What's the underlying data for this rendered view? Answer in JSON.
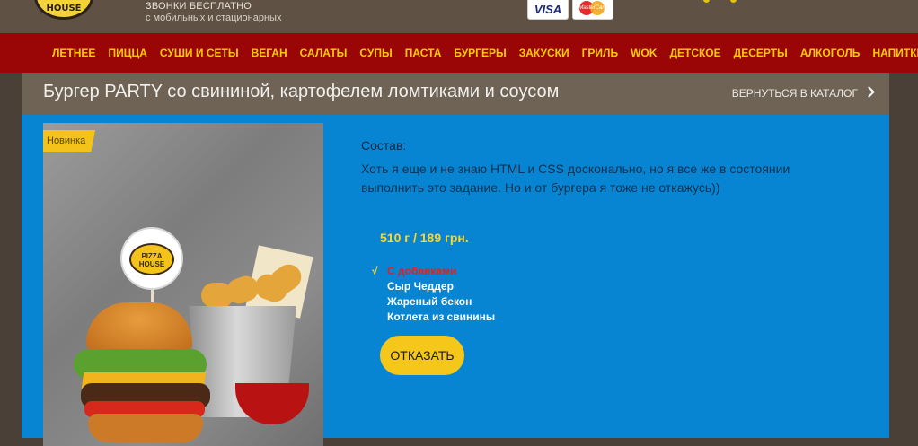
{
  "header": {
    "logo_text": "HOUSE",
    "calls_line1": "ЗВОНКИ БЕСПЛАТНО",
    "calls_line2": "с мобильных и стационарных",
    "payment_cards": [
      "VISA",
      "MasterCard"
    ]
  },
  "nav": {
    "items": [
      "ЛЕТНЕЕ",
      "ПИЦЦА",
      "СУШИ И СЕТЫ",
      "ВЕГАН",
      "САЛАТЫ",
      "СУПЫ",
      "ПАСТА",
      "БУРГЕРЫ",
      "ЗАКУСКИ",
      "ГРИЛЬ",
      "WOK",
      "ДЕТСКОЕ",
      "ДЕСЕРТЫ",
      "АЛКОГОЛЬ",
      "НАПИТКИ"
    ]
  },
  "page": {
    "title": "Бургер PARTY со свининой, картофелем ломтиками и соусом",
    "back_link": "ВЕРНУТЬСЯ В КАТАЛОГ"
  },
  "product": {
    "badge": "Новинка",
    "flag_text": "PIZZA HOUSE",
    "composition_label": "Состав:",
    "description": "Хоть я еще и не знаю HTML и CSS досконально, но я все же в состоянии выполнить это задание. Но и от бургера я тоже не откажусь))",
    "price": "510 г / 189 грн.",
    "options": [
      {
        "label": "С добавками",
        "checked": true
      },
      {
        "label": "Сыр Чеддер",
        "checked": false
      },
      {
        "label": "Жареный бекон",
        "checked": false
      },
      {
        "label": "Котлета из свинины",
        "checked": false
      }
    ],
    "order_button": "ОТКАЗАТЬ"
  },
  "colors": {
    "nav_bg": "#9a0606",
    "nav_text": "#ffcb05",
    "main_bg": "#0785d2",
    "price": "#ffd626",
    "button": "#f5c71a"
  }
}
